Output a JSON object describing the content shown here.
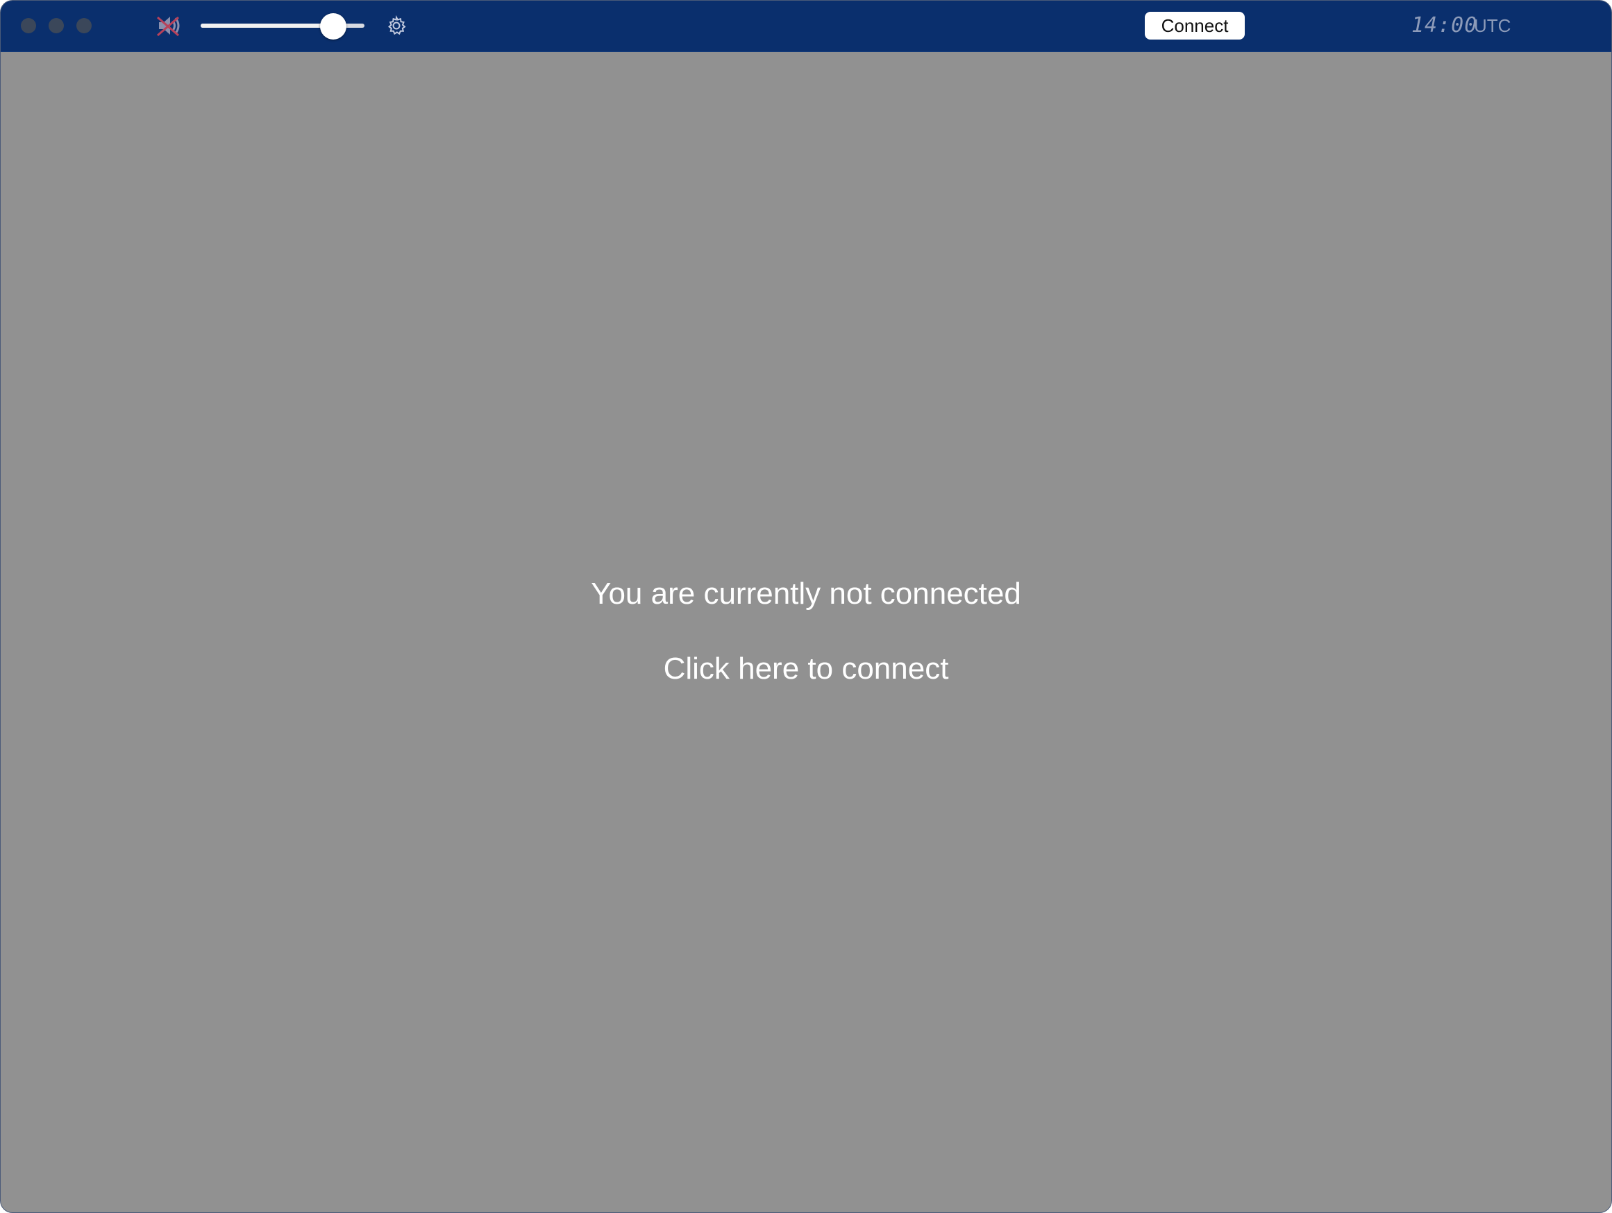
{
  "toolbar": {
    "volume_level": 0.81,
    "speaker_icon": "speaker-muted-icon",
    "settings_icon": "gear-icon",
    "connect_label": "Connect",
    "clock": "14:00",
    "timezone": "UTC"
  },
  "main": {
    "status_text": "You are currently not connected",
    "connect_link": "Click here to connect"
  },
  "colors": {
    "titlebar": "#0a2f6d",
    "content_bg": "#919191",
    "clock_text": "#8d9bb9",
    "muted_indicator": "#b8415a"
  }
}
